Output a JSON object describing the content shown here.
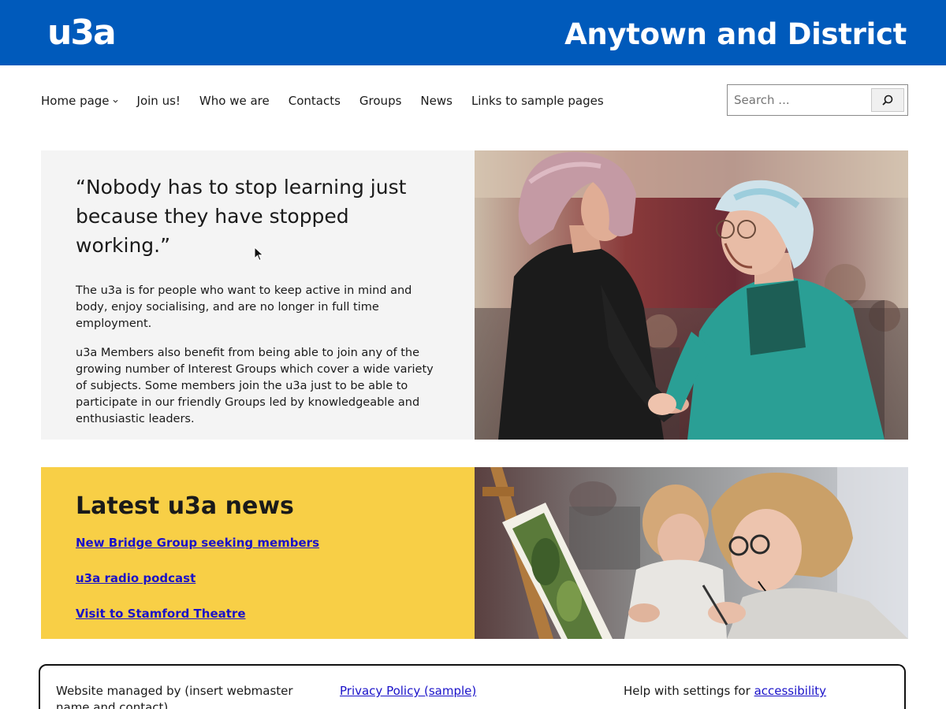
{
  "header": {
    "logo_text": "u3a",
    "site_title": "Anytown and District",
    "background_color": "#005abb"
  },
  "nav": {
    "items": [
      {
        "label": "Home page",
        "has_submenu": true
      },
      {
        "label": "Join us!"
      },
      {
        "label": "Who we are"
      },
      {
        "label": "Contacts"
      },
      {
        "label": "Groups"
      },
      {
        "label": "News"
      },
      {
        "label": "Links to sample pages"
      }
    ]
  },
  "search": {
    "placeholder": "Search ...",
    "button_icon": "search-icon"
  },
  "hero": {
    "quote": "“Nobody has to stop learning just because they have stopped working.”",
    "paragraph_1": "The u3a is for people who want to keep active in mind and body, enjoy socialising, and are no longer in full time employment.",
    "paragraph_2": "u3a Members also benefit from being able to join any of the growing number of Interest Groups which cover a wide variety of subjects. Some members join the u3a just to be able to participate in our friendly Groups led by knowledgeable and enthusiastic leaders.",
    "background_color": "#f4f4f4"
  },
  "news": {
    "title": "Latest u3a news",
    "links": [
      "New Bridge Group seeking members",
      "u3a radio podcast",
      "Visit to Stamford Theatre"
    ],
    "background_color": "#f8cf46",
    "link_color": "#1a12c9"
  },
  "footer": {
    "managed_by": "Website managed by (insert webmaster name and contact)",
    "privacy_link": "Privacy Policy (sample)",
    "help_text": "Help with settings for",
    "accessibility_link": "accessibility"
  }
}
